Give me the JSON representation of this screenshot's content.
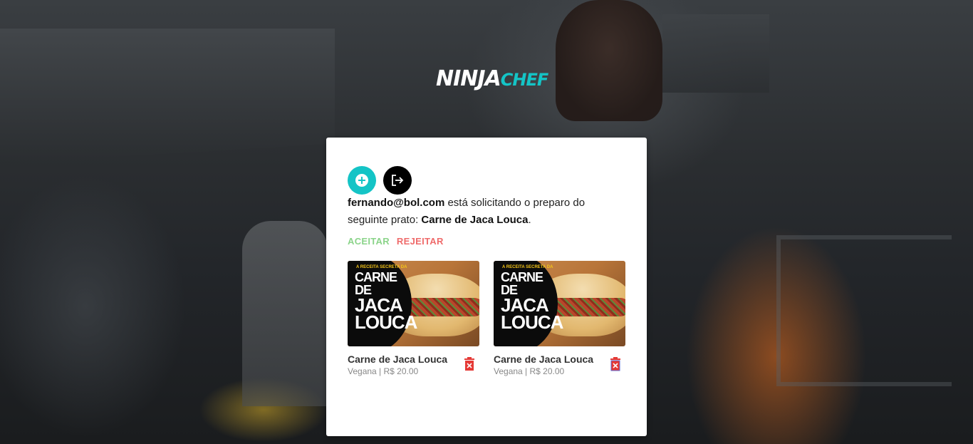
{
  "logo": {
    "ninja": "NINJA",
    "chef": "CHEF"
  },
  "toolbar": {
    "add_icon": "plus-circle-icon",
    "logout_icon": "logout-icon"
  },
  "request": {
    "email": "fernando@bol.com",
    "text_middle": " está solicitando o preparo do seguinte prato: ",
    "dish": "Carne de Jaca Louca",
    "end": "."
  },
  "actions": {
    "accept": "ACEITAR",
    "reject": "REJEITAR"
  },
  "colors": {
    "accent": "#14c4c6",
    "accept": "#8bd48a",
    "reject": "#ef6b6b",
    "delete_icon": "#e53935"
  },
  "dishes": [
    {
      "name": "Carne de Jaca Louca",
      "subtitle": "Vegana | R$ 20.00",
      "image_badge_top": "A RECEITA SECRETA DA",
      "image_badge_line1": "CARNE DE",
      "image_badge_line2": "JACA",
      "image_badge_line3": "LOUCA",
      "delete_icon": "trash-icon"
    },
    {
      "name": "Carne de Jaca Louca",
      "subtitle": "Vegana | R$ 20.00",
      "image_badge_top": "A RECEITA SECRETA DA",
      "image_badge_line1": "CARNE DE",
      "image_badge_line2": "JACA",
      "image_badge_line3": "LOUCA",
      "delete_icon": "trash-icon"
    }
  ]
}
